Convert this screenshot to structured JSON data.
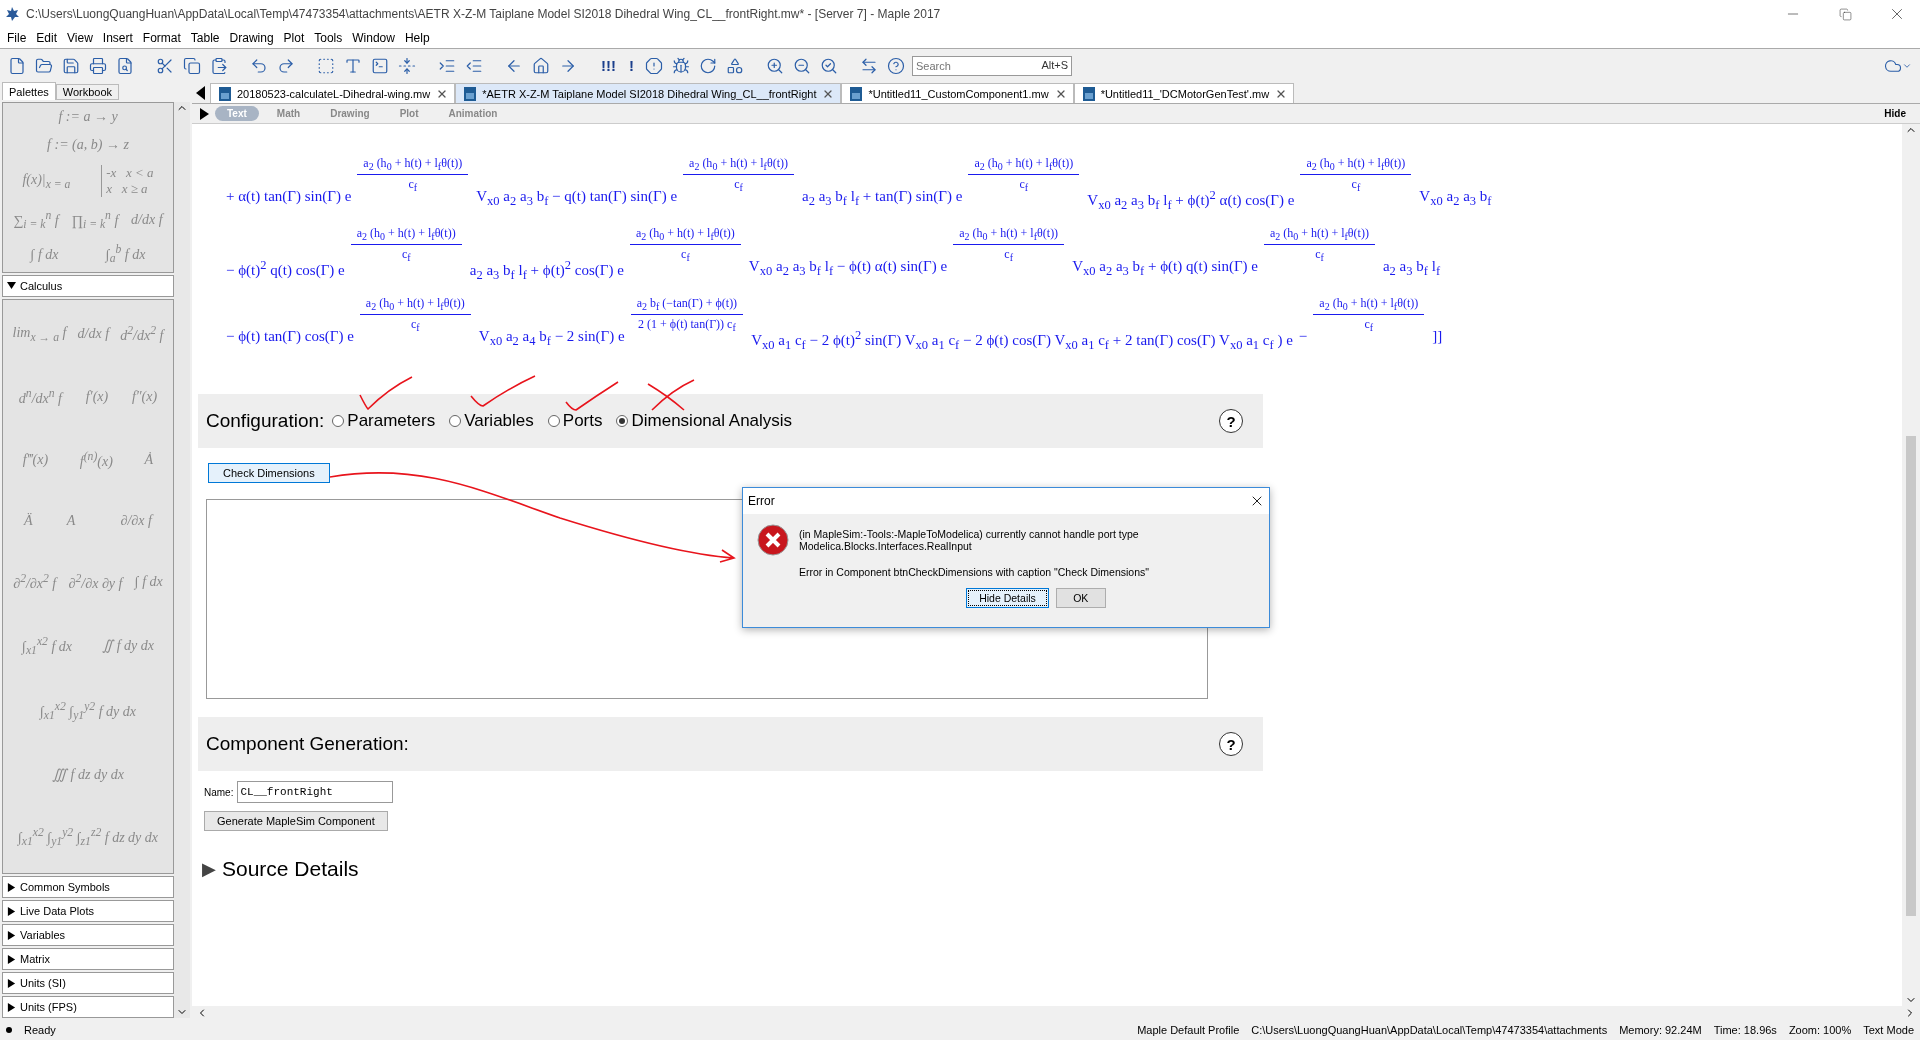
{
  "window": {
    "title": "C:\\Users\\LuongQuangHuan\\AppData\\Local\\Temp\\47473354\\attachments\\AETR X-Z-M Taiplane Model SI2018 Dihedral Wing_CL__frontRight.mw* - [Server 7] - Maple 2017"
  },
  "menu": [
    "File",
    "Edit",
    "View",
    "Insert",
    "Format",
    "Table",
    "Drawing",
    "Plot",
    "Tools",
    "Window",
    "Help"
  ],
  "toolbar": {
    "glyphs": [
      "!!!",
      "!"
    ],
    "search": {
      "placeholder": "Search",
      "shortcut": "Alt+S"
    }
  },
  "palette_tabs": [
    {
      "label": "Palettes",
      "selected": true
    },
    {
      "label": "Workbook",
      "selected": false
    }
  ],
  "palette": {
    "top_rows": [
      [
        "f := a → y"
      ],
      [
        "f := (a, b) → z"
      ],
      [
        "f(x)|$_{x = a}$",
        [
          "-x   x < a",
          "x   x ≥ a"
        ]
      ],
      [
        "∑$_{i = k}$$^{n}$ f",
        "∏$_{i = k}$$^{n}$ f",
        "d/dx f"
      ],
      [
        "∫ f dx",
        "∫$_{a}$$^{b}$ f dx"
      ]
    ],
    "sections": [
      {
        "title": "Calculus",
        "expanded": true,
        "rows": [
          [
            "lim$_{x → a}$ f",
            "d/dx f",
            "d$^{2}$/dx$^{2}$ f"
          ],
          [
            "d$^{n}$/dx$^{n}$ f",
            "f′(x)",
            "f″(x)"
          ],
          [
            "f‴(x)",
            "f$^{(n)}$(x)",
            "Ȧ"
          ],
          [
            "Ä",
            "A⃛",
            "∂/∂x f"
          ],
          [
            "∂$^{2}$/∂x$^{2}$ f",
            "∂$^{2}$/∂x ∂y f",
            "∫ f dx"
          ],
          [
            "∫$_{x1}$$^{x2}$ f dx",
            "∬ f dy dx"
          ],
          [
            "∫$_{x1}$$^{x2}$ ∫$_{y1}$$^{y2}$ f dy dx"
          ],
          [
            "∭ f dz dy dx"
          ],
          [
            "∫$_{x1}$$^{x2}$ ∫$_{y1}$$^{y2}$ ∫$_{z1}$$^{z2}$ f dz dy dx"
          ]
        ]
      },
      {
        "title": "Common Symbols",
        "expanded": false
      },
      {
        "title": "Live Data Plots",
        "expanded": false
      },
      {
        "title": "Variables",
        "expanded": false
      },
      {
        "title": "Matrix",
        "expanded": false
      },
      {
        "title": "Units (SI)",
        "expanded": false
      },
      {
        "title": "Units (FPS)",
        "expanded": false
      }
    ]
  },
  "doc_tabs": [
    {
      "title": "20180523-calculateL-Dihedral-wing.mw",
      "selected": false
    },
    {
      "title": "*AETR X-Z-M Taiplane Model SI2018 Dihedral Wing_CL__frontRight",
      "selected": true
    },
    {
      "title": "*Untitled11_CustomComponent1.mw",
      "selected": false
    },
    {
      "title": "*Untitled11_'DCMotorGenTest'.mw",
      "selected": false
    }
  ],
  "mode_tabs": [
    {
      "label": "Text",
      "selected": true
    },
    {
      "label": "Math",
      "selected": false
    },
    {
      "label": "Drawing",
      "selected": false
    },
    {
      "label": "Plot",
      "selected": false
    },
    {
      "label": "Animation",
      "selected": false
    }
  ],
  "hide_label": "Hide",
  "math_lines": [
    [
      {
        "kind": "text",
        "text": "+ α(t) tan(Γ) sin(Γ) e"
      },
      {
        "kind": "frac",
        "num": "a$_{2}$ (h$_{0}$ + h(t) + l$_{f}$θ(t))",
        "den": "c$_{f}$"
      },
      {
        "kind": "text",
        "text": "V$_{x0}$ a$_{2}$ a$_{3}$ b$_{f}$ − q(t) tan(Γ) sin(Γ) e"
      },
      {
        "kind": "frac",
        "num": "a$_{2}$ (h$_{0}$ + h(t) + l$_{f}$θ(t))",
        "den": "c$_{f}$"
      },
      {
        "kind": "text",
        "text": "a$_{2}$ a$_{3}$ b$_{f}$ l$_{f}$ + tan(Γ) sin(Γ) e"
      },
      {
        "kind": "frac",
        "num": "a$_{2}$ (h$_{0}$ + h(t) + l$_{f}$θ(t))",
        "den": "c$_{f}$"
      },
      {
        "kind": "text",
        "text": "V$_{x0}$ a$_{2}$ a$_{3}$ b$_{f}$ l$_{f}$ + ϕ(t)$^{2}$ α(t) cos(Γ) e"
      },
      {
        "kind": "frac",
        "num": "a$_{2}$ (h$_{0}$ + h(t) + l$_{f}$θ(t))",
        "den": "c$_{f}$"
      },
      {
        "kind": "text",
        "text": "V$_{x0}$ a$_{2}$ a$_{3}$ b$_{f}$"
      }
    ],
    [
      {
        "kind": "text",
        "text": "− ϕ(t)$^{2}$ q(t) cos(Γ) e"
      },
      {
        "kind": "frac",
        "num": "a$_{2}$ (h$_{0}$ + h(t) + l$_{f}$θ(t))",
        "den": "c$_{f}$"
      },
      {
        "kind": "text",
        "text": "a$_{2}$ a$_{3}$ b$_{f}$ l$_{f}$ + ϕ(t)$^{2}$ cos(Γ) e"
      },
      {
        "kind": "frac",
        "num": "a$_{2}$ (h$_{0}$ + h(t) + l$_{f}$θ(t))",
        "den": "c$_{f}$"
      },
      {
        "kind": "text",
        "text": "V$_{x0}$ a$_{2}$ a$_{3}$ b$_{f}$ l$_{f}$ − ϕ(t) α(t) sin(Γ) e"
      },
      {
        "kind": "frac",
        "num": "a$_{2}$ (h$_{0}$ + h(t) + l$_{f}$θ(t))",
        "den": "c$_{f}$"
      },
      {
        "kind": "text",
        "text": "V$_{x0}$ a$_{2}$ a$_{3}$ b$_{f}$ + ϕ(t) q(t) sin(Γ) e"
      },
      {
        "kind": "frac",
        "num": "a$_{2}$ (h$_{0}$ + h(t) + l$_{f}$θ(t))",
        "den": "c$_{f}$"
      },
      {
        "kind": "text",
        "text": "a$_{2}$ a$_{3}$ b$_{f}$ l$_{f}$"
      }
    ],
    [
      {
        "kind": "text",
        "text": "− ϕ(t) tan(Γ) cos(Γ) e"
      },
      {
        "kind": "frac",
        "num": "a$_{2}$ (h$_{0}$ + h(t) + l$_{f}$θ(t))",
        "den": "c$_{f}$"
      },
      {
        "kind": "text",
        "text": "V$_{x0}$ a$_{2}$ a$_{4}$ b$_{f}$ − 2 sin(Γ) e"
      },
      {
        "kind": "frac",
        "num": "a$_{2}$ b$_{f}$ (−tan(Γ) + ϕ(t))",
        "den": "2 (1 + ϕ(t) tan(Γ)) c$_{f}$"
      },
      {
        "kind": "text",
        "text": "V$_{x0}$ a$_{1}$ c$_{f}$ − 2 ϕ(t)$^{2}$ sin(Γ) V$_{x0}$ a$_{1}$ c$_{f}$ − 2 ϕ(t) cos(Γ) V$_{x0}$ a$_{1}$ c$_{f}$ + 2 tan(Γ) cos(Γ) V$_{x0}$ a$_{1}$ c$_{f}$ ) e"
      },
      {
        "kind": "text",
        "text": "−"
      },
      {
        "kind": "frac",
        "num": "a$_{2}$ (h$_{0}$ + h(t) + l$_{f}$θ(t))",
        "den": "c$_{f}$"
      },
      {
        "kind": "text",
        "text": "]]"
      }
    ]
  ],
  "configuration": {
    "label": "Configuration:",
    "help": "?",
    "options": [
      {
        "label": "Parameters",
        "selected": false
      },
      {
        "label": "Variables",
        "selected": false
      },
      {
        "label": "Ports",
        "selected": false
      },
      {
        "label": "Dimensional Analysis",
        "selected": true
      }
    ]
  },
  "check_button": "Check Dimensions",
  "component_generation": {
    "title": "Component Generation:",
    "help": "?",
    "name_label": "Name:",
    "name_value": "CL__frontRight",
    "generate_button": "Generate MapleSim Component"
  },
  "source_details": {
    "arrow": "▶",
    "title": "Source Details",
    "expanded": false
  },
  "dialog": {
    "title": "Error",
    "message": "(in MapleSim:-Tools:-MapleToModelica) currently cannot handle port type Modelica.Blocks.Interfaces.RealInput",
    "detail": "Error in Component btnCheckDimensions with caption \"Check Dimensions\"",
    "buttons": [
      {
        "label": "Hide Details",
        "selected": true
      },
      {
        "label": "OK",
        "selected": false
      }
    ]
  },
  "status_bar": {
    "status": "Ready",
    "profile": "Maple Default Profile",
    "path": "C:\\Users\\LuongQuangHuan\\AppData\\Local\\Temp\\47473354\\attachments",
    "memory": "Memory: 92.24M",
    "time": "Time: 18.96s",
    "zoom": "Zoom: 100%",
    "mode": "Text Mode"
  }
}
